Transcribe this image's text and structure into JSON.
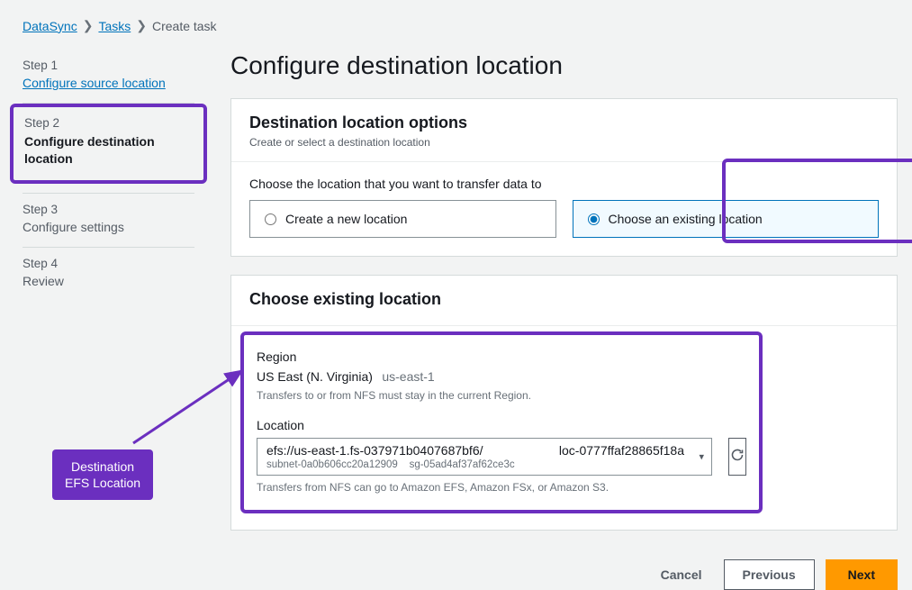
{
  "breadcrumb": {
    "items": [
      "DataSync",
      "Tasks"
    ],
    "current": "Create task"
  },
  "sidebar": {
    "steps": [
      {
        "num": "Step 1",
        "title": "Configure source location"
      },
      {
        "num": "Step 2",
        "title": "Configure destination location"
      },
      {
        "num": "Step 3",
        "title": "Configure settings"
      },
      {
        "num": "Step 4",
        "title": "Review"
      }
    ]
  },
  "page": {
    "title": "Configure destination location"
  },
  "options_panel": {
    "title": "Destination location options",
    "subtitle": "Create or select a destination location",
    "prompt": "Choose the location that you want to transfer data to",
    "radio_new": "Create a new location",
    "radio_existing": "Choose an existing location"
  },
  "existing_panel": {
    "title": "Choose existing location",
    "region_label": "Region",
    "region_name": "US East (N. Virginia)",
    "region_code": "us-east-1",
    "region_hint": "Transfers to or from NFS must stay in the current Region.",
    "location_label": "Location",
    "location_uri": "efs://us-east-1.fs-037971b0407687bf6/",
    "location_id": "loc-0777ffaf28865f18a",
    "subnet": "subnet-0a0b606cc20a12909",
    "sg": "sg-05ad4af37af62ce3c",
    "location_hint": "Transfers from NFS can go to Amazon EFS, Amazon FSx, or Amazon S3."
  },
  "footer": {
    "cancel": "Cancel",
    "previous": "Previous",
    "next": "Next"
  },
  "annotation": {
    "label_line1": "Destination",
    "label_line2": "EFS Location"
  }
}
